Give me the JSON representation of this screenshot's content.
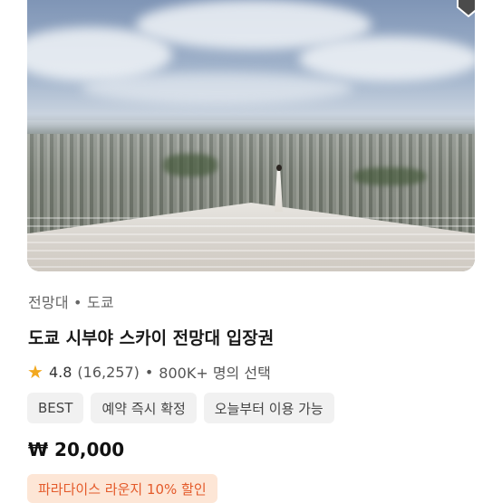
{
  "product": {
    "category": "전망대 • 도쿄",
    "title": "도쿄 시부야 스카이 전망대 입장권",
    "rating": "4.8",
    "review_count": "(16,257)",
    "separator": "•",
    "travellers": "800K+ 명의 선택",
    "tags": [
      "BEST",
      "예약 즉시 확정",
      "오늘부터 이용 가능"
    ],
    "price": "₩ 20,000",
    "promo": "파라다이스 라운지 10% 할인"
  },
  "icons": {
    "bookmark": "bookmark-icon",
    "star": "star-icon"
  },
  "colors": {
    "star": "#f2a81f",
    "promo_bg": "#fde6d6",
    "promo_text": "#e45a2a",
    "tag_bg": "#f1f1f1"
  }
}
